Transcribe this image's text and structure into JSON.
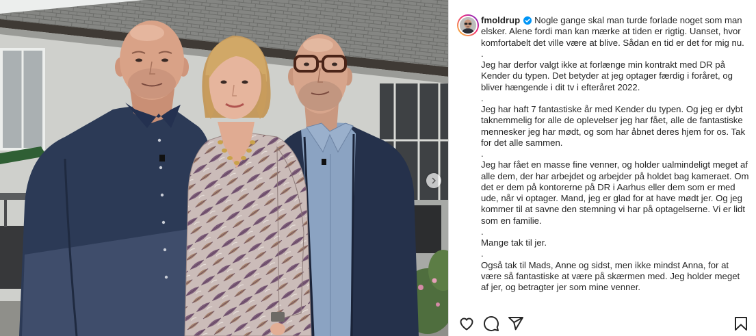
{
  "post": {
    "username": "fmoldrup",
    "verified": true,
    "caption": [
      "Nogle gange skal man turde forlade noget som man elsker. Alene fordi man kan mærke at tiden er rigtig. Uanset, hvor komfortabelt det ville være at blive. Sådan en tid er det for mig nu.",
      ".",
      "Jeg har derfor valgt ikke at forlænge min kontrakt med DR på Kender du typen. Det betyder at jeg optager færdig i foråret, og bliver hængende i dit tv i efteråret 2022.",
      ".",
      "Jeg har haft 7 fantastiske år med Kender du typen. Og jeg er dybt taknemmelig for alle de oplevelser jeg har fået, alle de fantastiske mennesker jeg har mødt, og som har åbnet deres hjem for os. Tak for det alle sammen.",
      ".",
      "Jeg har fået en masse fine venner, og holder ualmindeligt meget af alle dem, der har arbejdet og arbejder på holdet bag kameraet. Om det er dem på kontorerne på DR i Aarhus eller dem som er med ude, når vi optager. Mand, jeg er glad for at have mødt jer. Og jeg kommer til at savne den stemning vi har på optagelserne. Vi er lidt som en familie.",
      ".",
      "Mange tak til jer.",
      ".",
      "Også tak til Mads, Anne og sidst, men ikke mindst Anna, for at være så fantastiske at være på skærmen med. Jeg holder meget af jer, og betragter jer som mine venner."
    ]
  },
  "photo": {
    "next_icon": "chevron-right-icon"
  },
  "actions": {
    "like_icon": "heart-icon",
    "comment_icon": "comment-icon",
    "share_icon": "share-icon",
    "save_icon": "bookmark-icon"
  },
  "colors": {
    "text": "#262626",
    "verified": "#0095f6",
    "divider": "#dbdbdb",
    "avatar_ring_start": "#f9ce34",
    "avatar_ring_end": "#ee2a7b"
  }
}
